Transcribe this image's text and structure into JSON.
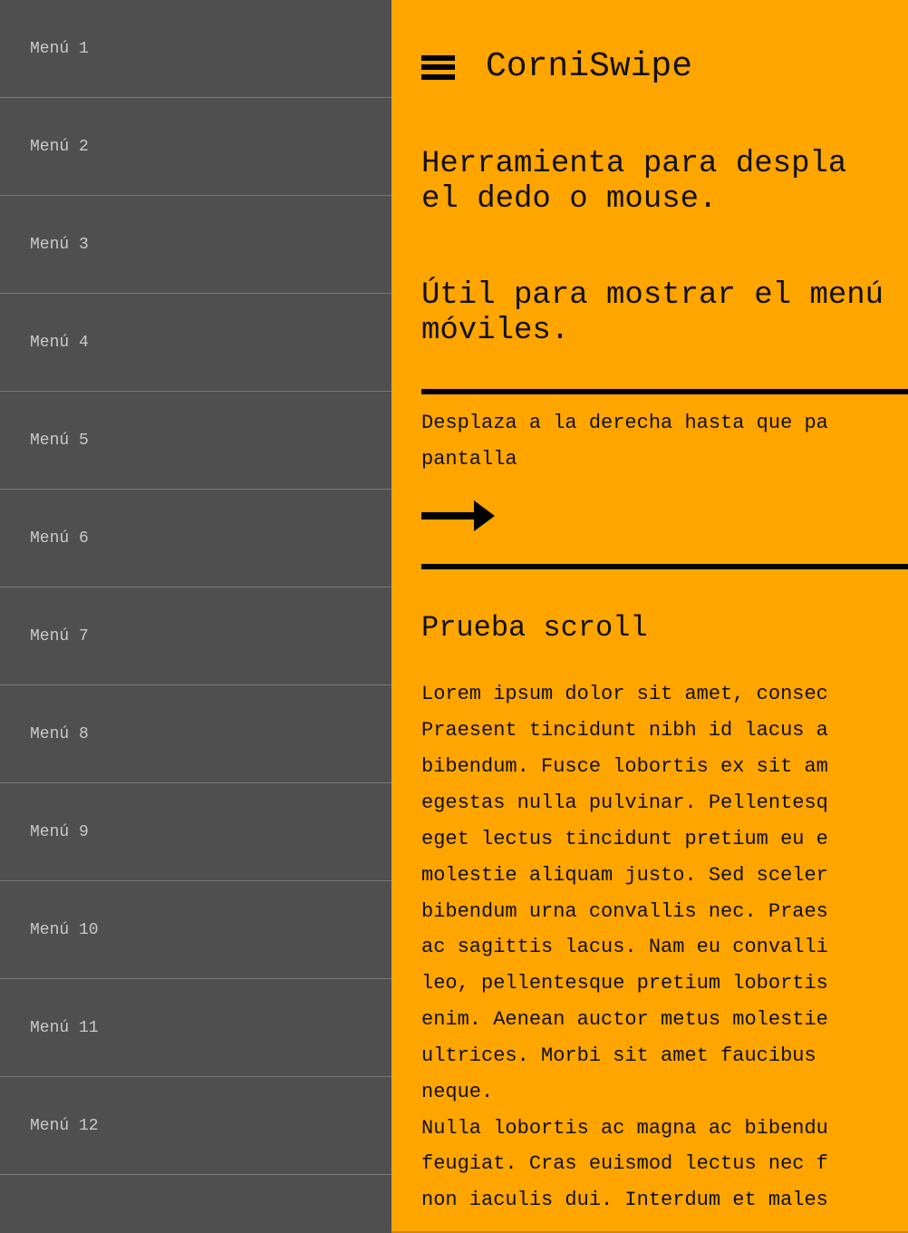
{
  "sidebar": {
    "items": [
      {
        "label": "Menú 1"
      },
      {
        "label": "Menú 2"
      },
      {
        "label": "Menú 3"
      },
      {
        "label": "Menú 4"
      },
      {
        "label": "Menú 5"
      },
      {
        "label": "Menú 6"
      },
      {
        "label": "Menú 7"
      },
      {
        "label": "Menú 8"
      },
      {
        "label": "Menú 9"
      },
      {
        "label": "Menú 10"
      },
      {
        "label": "Menú 11"
      },
      {
        "label": "Menú 12"
      }
    ]
  },
  "header": {
    "menu_icon": "hamburger-menu-icon",
    "title": "CorniSwipe"
  },
  "intro": {
    "lines": [
      "Herramienta para despla",
      "el dedo o mouse."
    ]
  },
  "use_case": {
    "lines": [
      "Útil para mostrar el menú",
      "móviles."
    ]
  },
  "instruction": {
    "lines": [
      "Desplaza a la derecha hasta que pa",
      "pantalla"
    ],
    "arrow_icon": "arrow-right-icon"
  },
  "scroll_section": {
    "title": "Prueba scroll",
    "lines": [
      "Lorem ipsum dolor sit amet, consec",
      "Praesent tincidunt nibh id lacus a",
      "bibendum. Fusce lobortis ex sit am",
      "egestas nulla pulvinar. Pellentesq",
      "eget lectus tincidunt pretium eu e",
      "molestie aliquam justo. Sed sceler",
      "bibendum urna convallis nec. Praes",
      "ac sagittis lacus. Nam eu convalli",
      "leo, pellentesque pretium lobortis",
      "enim. Aenean auctor metus molestie",
      "ultrices. Morbi sit amet faucibus ",
      "neque.",
      "Nulla lobortis ac magna ac bibendu",
      "feugiat. Cras euismod lectus nec f",
      "non iaculis dui. Interdum et males"
    ]
  },
  "colors": {
    "sidebar_bg": "#4f4f4f",
    "sidebar_text": "#c9c9c9",
    "main_bg": "#ffa500",
    "text": "#111111"
  }
}
